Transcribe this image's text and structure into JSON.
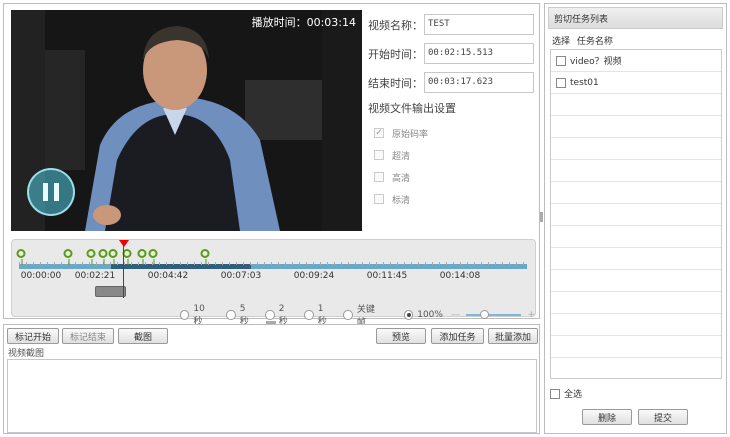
{
  "video": {
    "play_time_label": "播放时间：00:03:14"
  },
  "form": {
    "name_label": "视频名称：",
    "name_value": "TEST",
    "start_label": "开始时间：",
    "start_value": "00:02:15.513",
    "end_label": "结束时间：",
    "end_value": "00:03:17.623",
    "output_title": "视频文件输出设置",
    "options": [
      {
        "label": "原始码率",
        "checked": true
      },
      {
        "label": "超清",
        "checked": false
      },
      {
        "label": "高清",
        "checked": false
      },
      {
        "label": "标清",
        "checked": false
      }
    ]
  },
  "timeline": {
    "time_labels": [
      "00:00:00",
      "00:02:21",
      "00:04:42",
      "00:07:03",
      "00:09:24",
      "00:11:45",
      "00:14:08"
    ],
    "step_options": [
      "10秒",
      "5秒",
      "2秒",
      "1秒",
      "关键帧"
    ],
    "zoom_label": "100%",
    "zoom_minus": "—",
    "zoom_plus": "+"
  },
  "bottom": {
    "buttons": {
      "mark_start": "标记开始",
      "mark_end": "标记结束",
      "screenshot": "截图",
      "preview": "预览",
      "add_task": "添加任务",
      "batch_add": "批量添加"
    },
    "screenshot_label": "视频截图"
  },
  "tasks": {
    "title": "剪切任务列表",
    "col_select": "选择",
    "col_name": "任务名称",
    "items": [
      {
        "name": "video？视频"
      },
      {
        "name": "test01"
      }
    ],
    "select_all": "全选",
    "delete_label": "删除",
    "submit_label": "提交"
  },
  "colors": {
    "track": "#6aa8c8",
    "track_dark": "#2f5f7c",
    "marker": "#5a9a1e",
    "playhead": "#e00000"
  }
}
